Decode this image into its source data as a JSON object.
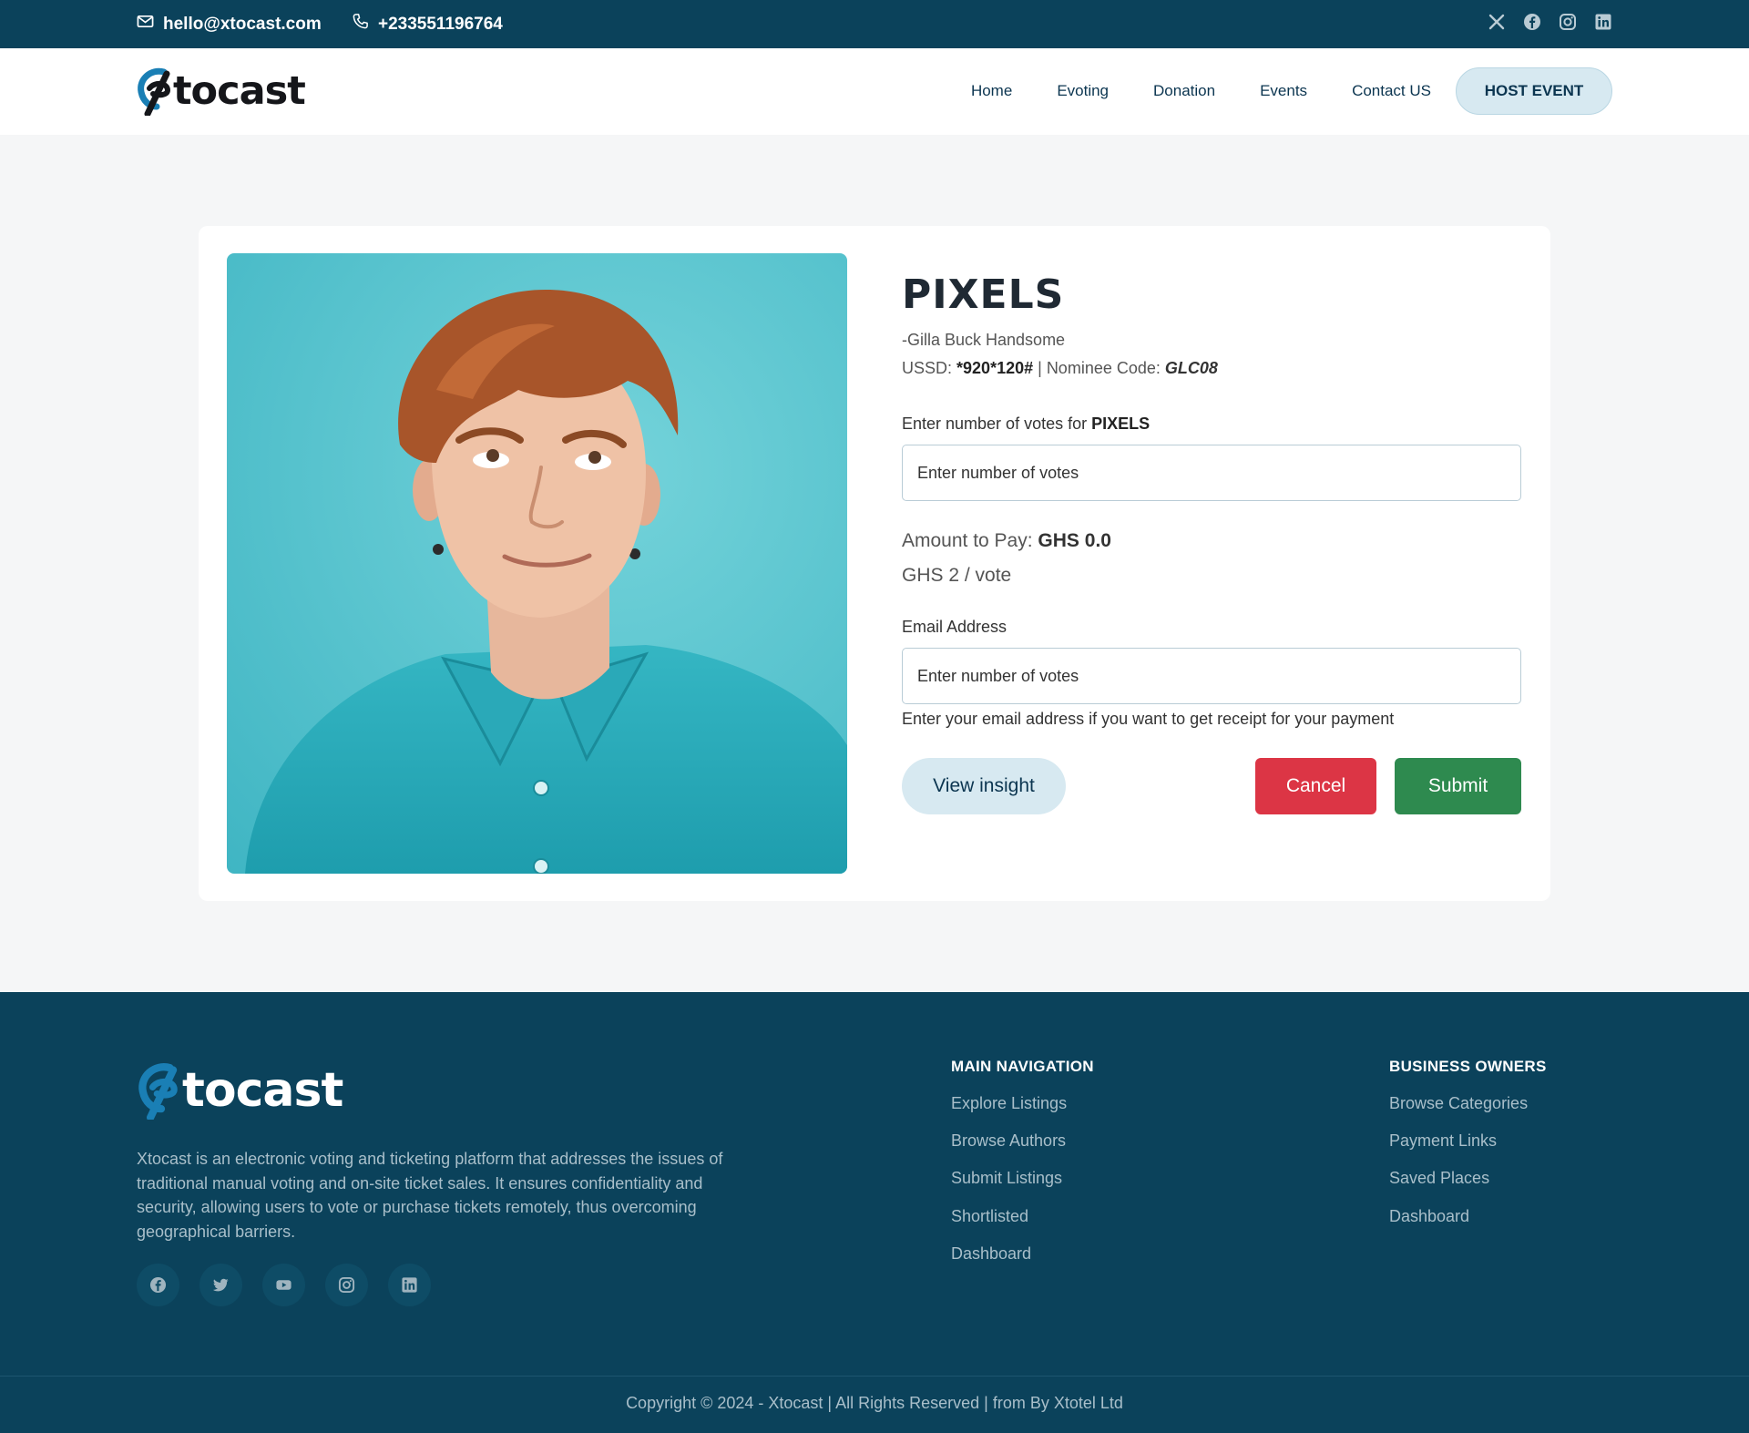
{
  "topbar": {
    "email": "hello@xtocast.com",
    "phone": "+233551196764",
    "social_icons": [
      "x-icon",
      "facebook-icon",
      "instagram-icon",
      "linkedin-icon"
    ]
  },
  "header": {
    "logo_text": "tocast",
    "nav": [
      "Home",
      "Evoting",
      "Donation",
      "Events",
      "Contact US"
    ],
    "cta": "HOST EVENT"
  },
  "nominee": {
    "name": "PIXELS",
    "subtitle": "-Gilla Buck Handsome",
    "ussd_label": "USSD:",
    "ussd_code": "*920*120#",
    "separator": " | ",
    "nominee_code_label": "Nominee Code:",
    "nominee_code": "GLC08"
  },
  "form": {
    "votes_label_prefix": "Enter number of votes for",
    "votes_label_name": "PIXELS",
    "votes_placeholder": "Enter number of votes",
    "amount_label": "Amount to Pay:",
    "amount_value": "GHS 0.0",
    "rate": "GHS 2 / vote",
    "email_label": "Email Address",
    "email_placeholder": "Enter number of votes",
    "email_hint": "Enter your email address if you want to get receipt for your payment",
    "view_insight": "View insight",
    "cancel": "Cancel",
    "submit": "Submit"
  },
  "footer": {
    "logo_text": "tocast",
    "about": "Xtocast is an electronic voting and ticketing platform that addresses the issues of traditional manual voting and on-site ticket sales. It ensures confidentiality and security, allowing users to vote or purchase tickets remotely, thus overcoming geographical barriers.",
    "social_icons": [
      "facebook-icon",
      "twitter-icon",
      "youtube-icon",
      "instagram-icon",
      "linkedin-icon"
    ],
    "col1_title": "MAIN NAVIGATION",
    "col1_links": [
      "Explore Listings",
      "Browse Authors",
      "Submit Listings",
      "Shortlisted",
      "Dashboard"
    ],
    "col2_title": "BUSINESS OWNERS",
    "col2_links": [
      "Browse Categories",
      "Payment Links",
      "Saved Places",
      "Dashboard"
    ],
    "copyright": "Copyright © 2024 - Xtocast | All Rights Reserved | from By Xtotel Ltd"
  },
  "colors": {
    "brand_dark": "#0b425b",
    "accent_light": "#d7e9f1",
    "cancel": "#dc3545",
    "submit": "#2e8a4f",
    "logo_blue": "#1a7fb5"
  }
}
